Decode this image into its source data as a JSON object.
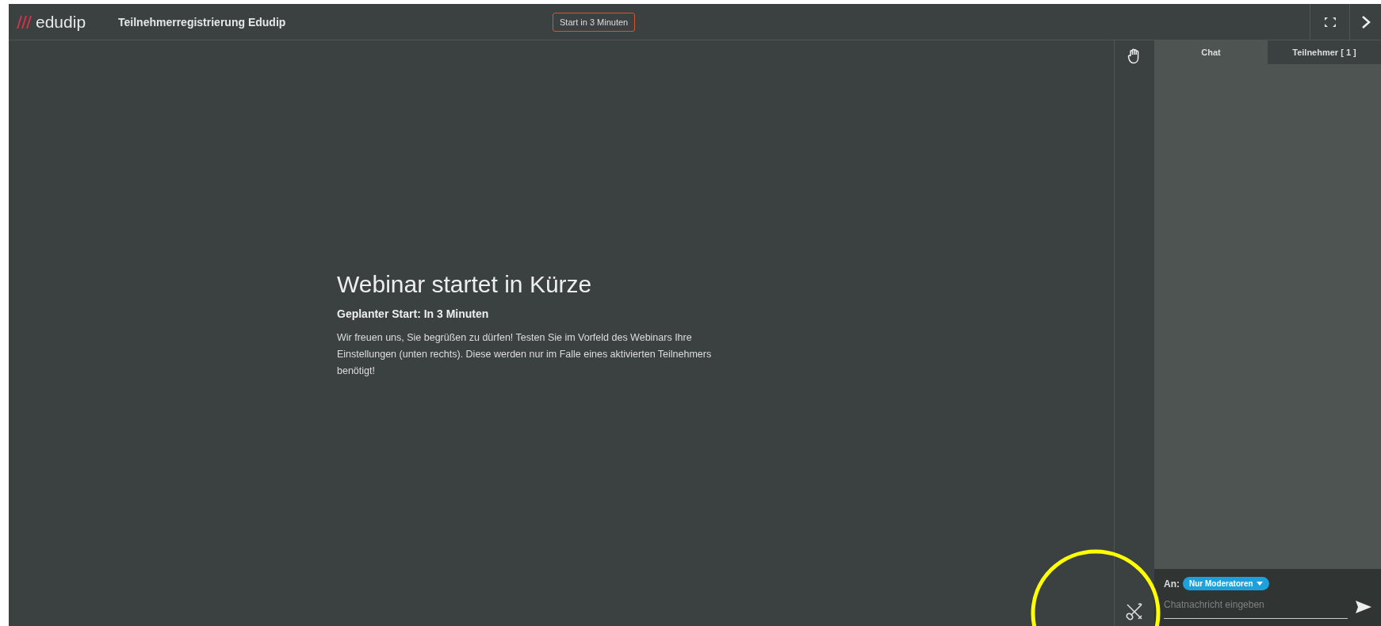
{
  "header": {
    "logo": "edudip",
    "title": "Teilnehmerregistrierung Edudip",
    "countdown": "Start in 3 Minuten"
  },
  "stage": {
    "heading": "Webinar startet in Kürze",
    "subheading": "Geplanter Start: In 3 Minuten",
    "message": "Wir freuen uns, Sie begrüßen zu dürfen! Testen Sie im Vorfeld des Webinars Ihre Einstellungen (unten rechts). Diese werden nur im Falle eines aktivierten Teilnehmers benötigt!"
  },
  "tabs": [
    {
      "label": "Chat",
      "selected": true
    },
    {
      "label": "Teilnehmer [ 1 ]",
      "selected": false
    }
  ],
  "chat": {
    "recipient_label": "An:",
    "recipient": "Nur Moderatoren",
    "placeholder": "Chatnachricht eingeben"
  }
}
